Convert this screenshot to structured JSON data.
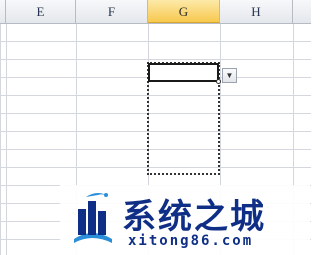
{
  "columns": [
    {
      "label": "E",
      "selected": false
    },
    {
      "label": "F",
      "selected": false
    },
    {
      "label": "G",
      "selected": true
    },
    {
      "label": "H",
      "selected": false
    }
  ],
  "icons": {
    "dropdown": "chevron-down-icon",
    "logo": "building-logo-icon"
  },
  "colors": {
    "selected_header": "#f7c94f",
    "watermark_text": "#0f2f86"
  },
  "watermark": {
    "title": "系统之城",
    "url": "xitong86.com"
  }
}
